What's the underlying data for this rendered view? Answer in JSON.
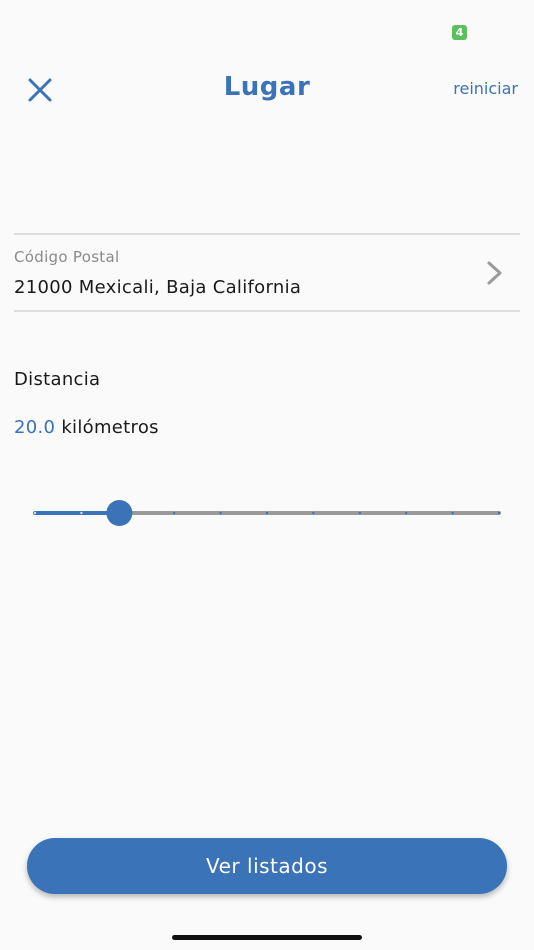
{
  "status_bar": {
    "badge": "4"
  },
  "header": {
    "title": "Lugar",
    "reset_label": "reiniciar"
  },
  "postal": {
    "label": "Código Postal",
    "value": "21000 Mexicali, Baja California"
  },
  "distance": {
    "label": "Distancia",
    "value": "20.0",
    "unit": "kilómetros"
  },
  "slider": {
    "min_value": 0,
    "max_value": 110,
    "value": 20.0,
    "step_count": 11
  },
  "footer": {
    "button_label": "Ver listados"
  },
  "colors": {
    "accent": "#3a73b7",
    "badge": "#5cc05f",
    "track_inactive": "#9a9a9a"
  },
  "icons": {
    "close": "close-icon",
    "chevron": "chevron-right-icon"
  }
}
